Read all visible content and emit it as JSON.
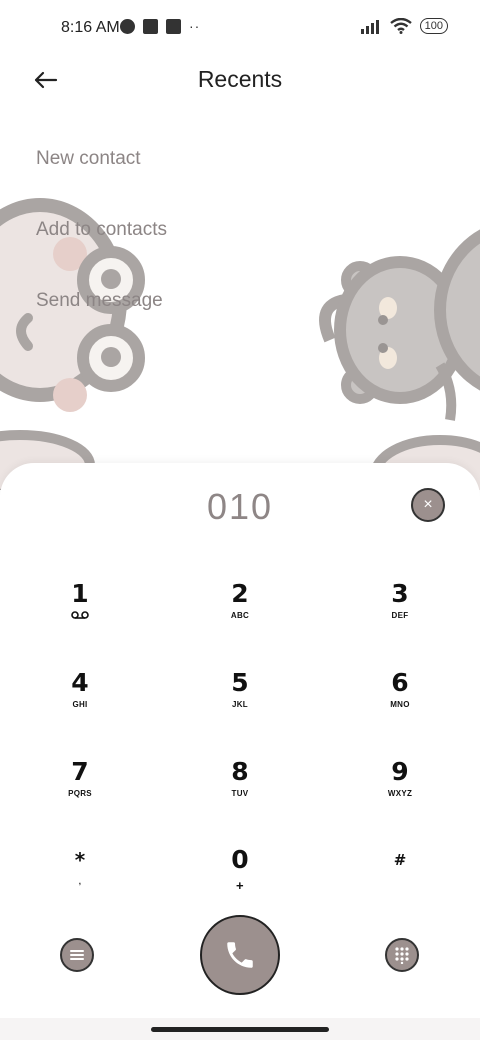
{
  "status_bar": {
    "time": "8:16 AM",
    "battery": "100",
    "dots": "··"
  },
  "header": {
    "title": "Recents"
  },
  "menu": {
    "items": [
      "New contact",
      "Add to contacts",
      "Send message"
    ]
  },
  "dialer": {
    "number": "010",
    "clear_icon": "×",
    "keys": [
      {
        "digit": "1",
        "letters": ""
      },
      {
        "digit": "2",
        "letters": "ABC"
      },
      {
        "digit": "3",
        "letters": "DEF"
      },
      {
        "digit": "4",
        "letters": "GHI"
      },
      {
        "digit": "5",
        "letters": "JKL"
      },
      {
        "digit": "6",
        "letters": "MNO"
      },
      {
        "digit": "7",
        "letters": "PQRS"
      },
      {
        "digit": "8",
        "letters": "TUV"
      },
      {
        "digit": "9",
        "letters": "WXYZ"
      },
      {
        "digit": "*",
        "letters": ","
      },
      {
        "digit": "0",
        "letters": "+"
      },
      {
        "digit": "#",
        "letters": ""
      }
    ]
  },
  "colors": {
    "accent": "#9c908e",
    "menu_text": "#8c8585",
    "number_text": "#8e8686"
  },
  "icons": {
    "back": "arrow-left-icon",
    "voicemail": "voicemail-icon",
    "menu": "menu-icon",
    "call": "phone-icon",
    "keypad": "dialpad-icon"
  }
}
